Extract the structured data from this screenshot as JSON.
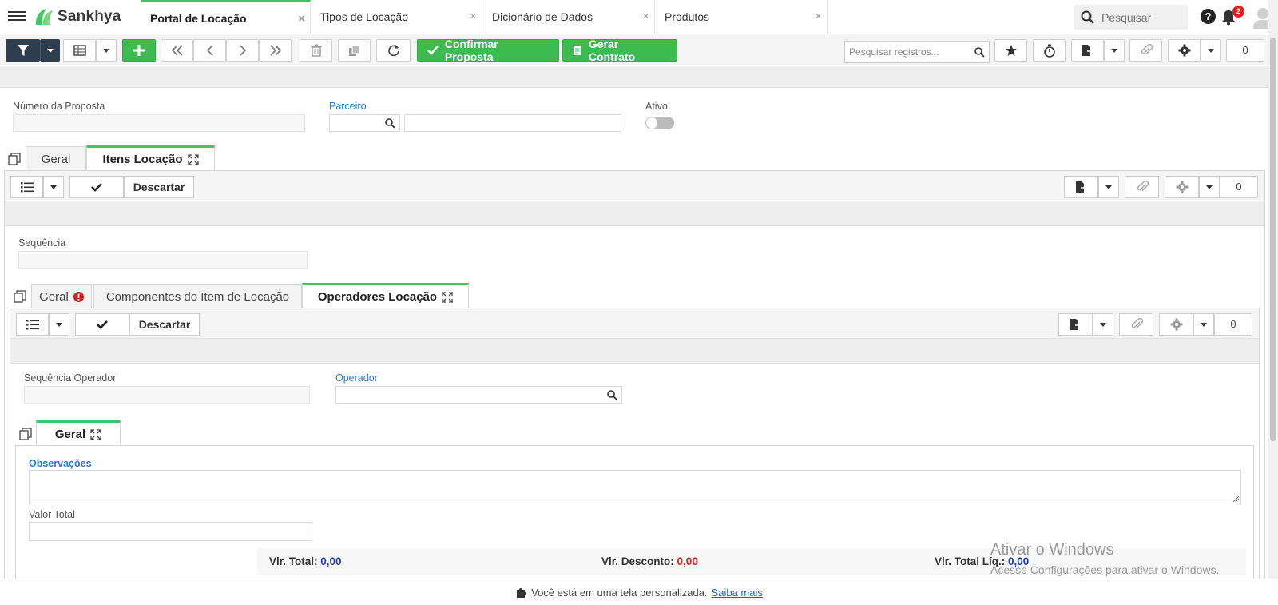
{
  "app": {
    "brand": "Sankhya",
    "brand_color": "#44c464"
  },
  "tabs": [
    {
      "label": "Portal de Locação",
      "active": true,
      "close": "×"
    },
    {
      "label": "Tipos de Locação",
      "close": "×"
    },
    {
      "label": "Dicionário de Dados",
      "close": "×"
    },
    {
      "label": "Produtos",
      "close": "×"
    }
  ],
  "global_search": {
    "placeholder": "Pesquisar"
  },
  "notifications": {
    "count": "2"
  },
  "toolbar": {
    "confirm_label": "Confirmar Proposta",
    "contract_label": "Gerar Contrato",
    "search_placeholder": "Pesquisar registros...",
    "counter": "0"
  },
  "form": {
    "numero_label": "Número da Proposta",
    "parceiro_label": "Parceiro",
    "ativo_label": "Ativo",
    "ativo_value": false
  },
  "main_tabs": [
    {
      "label": "Geral"
    },
    {
      "label": "Itens Locação",
      "active": true
    }
  ],
  "itens": {
    "descartar_label": "Descartar",
    "counter": "0",
    "sequencia_label": "Sequência"
  },
  "item_tabs": [
    {
      "label": "Geral",
      "error": true
    },
    {
      "label": "Componentes do Item de Locação"
    },
    {
      "label": "Operadores Locação",
      "active": true
    }
  ],
  "operadores": {
    "descartar_label": "Descartar",
    "counter": "0",
    "seq_label": "Sequência Operador",
    "operador_label": "Operador"
  },
  "op_tabs": [
    {
      "label": "Geral",
      "active": true
    }
  ],
  "detail": {
    "obs_label": "Observações",
    "valor_label": "Valor Total"
  },
  "totals": {
    "vlr_total_label": "Vlr. Total:",
    "vlr_total": "0,00",
    "vlr_desconto_label": "Vlr. Desconto:",
    "vlr_desconto": "0,00",
    "vlr_liq_label": "Vlr. Total Líq.:",
    "vlr_liq": "0,00"
  },
  "watermark": {
    "title": "Ativar o Windows",
    "subtitle": "Acesse Configurações para ativar o Windows."
  },
  "footer": {
    "text": "Você está em uma tela personalizada.",
    "link": "Saiba mais"
  }
}
